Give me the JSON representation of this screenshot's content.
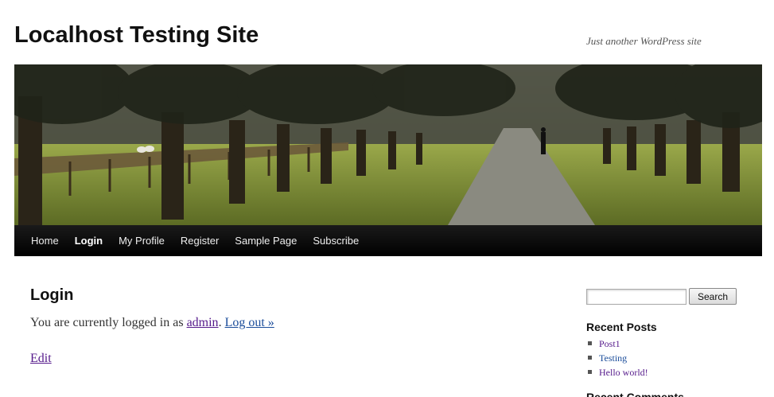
{
  "site": {
    "title": "Localhost Testing Site",
    "description": "Just another WordPress site"
  },
  "header_image": {
    "description": "Tree-lined country lane with fence and pedestrian"
  },
  "nav": {
    "items": [
      {
        "label": "Home"
      },
      {
        "label": "Login"
      },
      {
        "label": "My Profile"
      },
      {
        "label": "Register"
      },
      {
        "label": "Sample Page"
      },
      {
        "label": "Subscribe"
      }
    ],
    "current": "Login"
  },
  "page": {
    "title": "Login",
    "logged_in_prefix": "You are currently logged in as ",
    "username": "admin",
    "separator": ". ",
    "logout_label": "Log out »",
    "edit_label": "Edit"
  },
  "sidebar": {
    "search_placeholder": "",
    "search_button": "Search",
    "recent_posts_title": "Recent Posts",
    "recent_posts": [
      "Post1",
      "Testing",
      "Hello world!"
    ],
    "recent_comments_title": "Recent Comments"
  },
  "colors": {
    "link_visited": "#551a8b",
    "link": "#1a4c9a",
    "nav_bg": "#000000"
  }
}
